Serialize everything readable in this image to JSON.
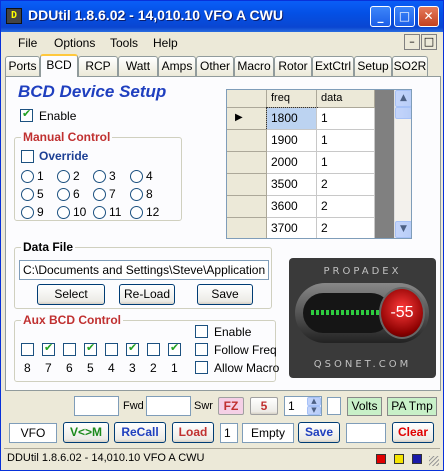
{
  "window": {
    "title": "DDUtil 1.8.6.02 - 14,010.10  VFO A  CWU"
  },
  "menu": [
    "File",
    "Options",
    "Tools",
    "Help"
  ],
  "tabs": [
    "Ports",
    "BCD",
    "RCP",
    "Watt",
    "Amps",
    "Other",
    "Macro",
    "Rotor",
    "ExtCtrl",
    "Setup",
    "SO2R"
  ],
  "active_tab": "BCD",
  "bcd": {
    "heading": "BCD Device Setup",
    "enable_label": "Enable",
    "enable_checked": true,
    "manual_control": {
      "title": "Manual Control",
      "override_label": "Override",
      "override_checked": false,
      "radios": [
        "1",
        "2",
        "3",
        "4",
        "5",
        "6",
        "7",
        "8",
        "9",
        "10",
        "11",
        "12"
      ]
    },
    "grid": {
      "columns": [
        "freq",
        "data"
      ],
      "rows": [
        {
          "freq": "1800",
          "data": "1"
        },
        {
          "freq": "1900",
          "data": "1"
        },
        {
          "freq": "2000",
          "data": "1"
        },
        {
          "freq": "3500",
          "data": "2"
        },
        {
          "freq": "3600",
          "data": "2"
        },
        {
          "freq": "3700",
          "data": "2"
        }
      ]
    },
    "data_file": {
      "title": "Data File",
      "path": "C:\\Documents and Settings\\Steve\\Application Dat",
      "select_label": "Select",
      "reload_label": "Re-Load",
      "save_label": "Save"
    },
    "aux": {
      "title": "Aux BCD Control",
      "bits": [
        {
          "label": "8",
          "checked": false
        },
        {
          "label": "7",
          "checked": true
        },
        {
          "label": "6",
          "checked": false
        },
        {
          "label": "5",
          "checked": true
        },
        {
          "label": "4",
          "checked": false
        },
        {
          "label": "3",
          "checked": true
        },
        {
          "label": "2",
          "checked": false
        },
        {
          "label": "1",
          "checked": true
        }
      ],
      "enable_label": "Enable",
      "follow_label": "Follow Freq",
      "allow_macro_label": "Allow Macro"
    },
    "gauge": {
      "top_text": "PROPADEX",
      "bottom_text": "QSONET.COM",
      "value": "-55"
    }
  },
  "row1": {
    "fwd_label": "Fwd",
    "swr_label": "Swr",
    "fz_label": "FZ",
    "five_label": "5",
    "spin_value": "1",
    "volts_label": "Volts",
    "patmp_label": "PA Tmp"
  },
  "row2": {
    "vfo_value": "VFO",
    "vm_label": "V<>M",
    "recall_label": "ReCall",
    "load_label": "Load",
    "mem_value": "1",
    "empty_value": "Empty",
    "save_label": "Save",
    "clear_label": "Clear"
  },
  "statusbar": {
    "text": "DDUtil 1.8.6.02 - 14,010.10  VFO A  CWU"
  },
  "colors": {
    "accent_red": "#c03030",
    "accent_blue": "#1f3fbf",
    "status_green": "#c8f0c8"
  }
}
